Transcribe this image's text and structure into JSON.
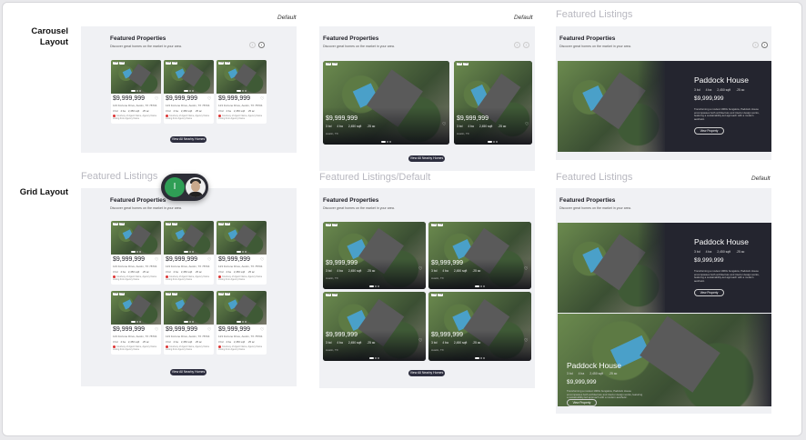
{
  "row_labels": {
    "carousel": "Carousel Layout",
    "grid": "Grid Layout"
  },
  "frame_labels": {
    "listings_top_right": "Featured Listings",
    "listings_grid_left": "Featured Listings",
    "listings_default_mid": "Featured Listings/Default",
    "listings_grid_right": "Featured Listings"
  },
  "variant_default": "Default",
  "section": {
    "title": "Featured Properties",
    "subtitle": "Discover great homes on the market in your area.",
    "cta": "View All Nearby Homes"
  },
  "card": {
    "tag": "Chip",
    "price": "$9,999,999",
    "address": "123 Fortune Drive, Austin, TX 78704",
    "address_short": "Austin, TX",
    "specs": {
      "beds": "3 bd",
      "baths": "4 ba",
      "sqft": "2,450 sqft",
      "ac": ".25 ac"
    },
    "agent_line1": "Courtesy of Agent Name, Agency Name",
    "agent_line2": "Listing from Agency Name"
  },
  "hero": {
    "title": "Paddock House",
    "specs": {
      "beds": "3 bd",
      "baths": "4 ba",
      "sqft": "2,450 sqft",
      "ac": ".25 ac"
    },
    "price": "$9,999,999",
    "description": "Transforming a modest 1960s bungalow, Paddock House encompasses both architecture and interior design works, featuring a sustainability-led approach with a modern aesthetic.",
    "cta": "View Property"
  },
  "toggle": {
    "knob_label": "I",
    "avatar": "user-avatar"
  },
  "icons": {
    "heart": "heart-icon",
    "prev": "chevron-left-icon",
    "next": "chevron-right-icon"
  },
  "colors": {
    "accent_green": "#2f9e55",
    "dark_button": "#2d2e3f",
    "frame_bg": "#f0f1f4"
  }
}
